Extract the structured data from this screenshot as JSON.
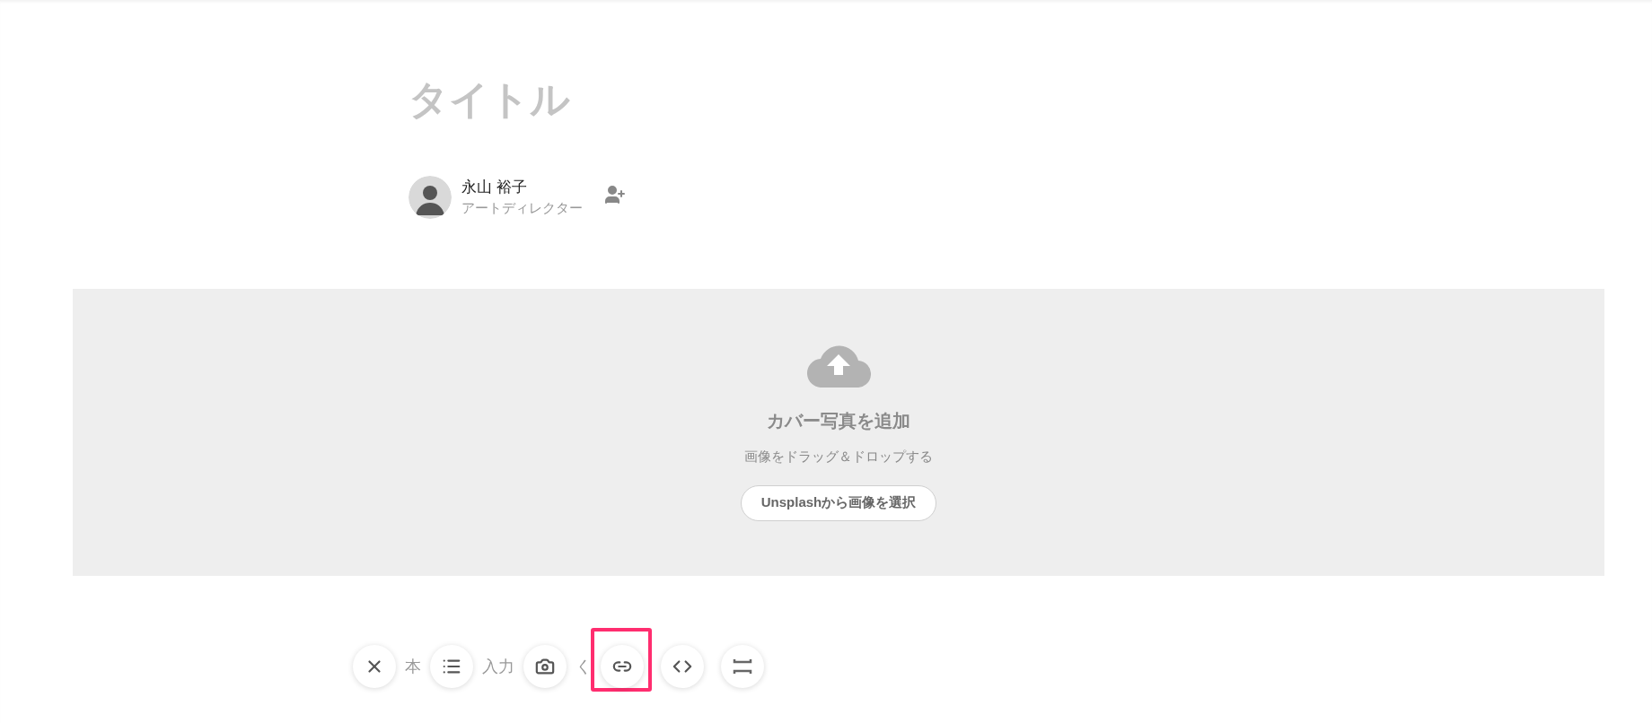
{
  "title": {
    "placeholder": "タイトル"
  },
  "author": {
    "name": "永山 裕子",
    "role": "アートディレクター"
  },
  "cover": {
    "heading": "カバー写真を追加",
    "hint": "画像をドラッグ＆ドロップする",
    "button": "Unsplashから画像を選択"
  },
  "body": {
    "placeholder_fragments": [
      "本",
      "入力",
      "く"
    ]
  },
  "tools": [
    {
      "kind": "close",
      "highlighted": false
    },
    {
      "kind": "list",
      "highlighted": false
    },
    {
      "kind": "camera",
      "highlighted": false
    },
    {
      "kind": "link",
      "highlighted": true
    },
    {
      "kind": "code",
      "highlighted": false
    },
    {
      "kind": "divider",
      "highlighted": false
    }
  ]
}
